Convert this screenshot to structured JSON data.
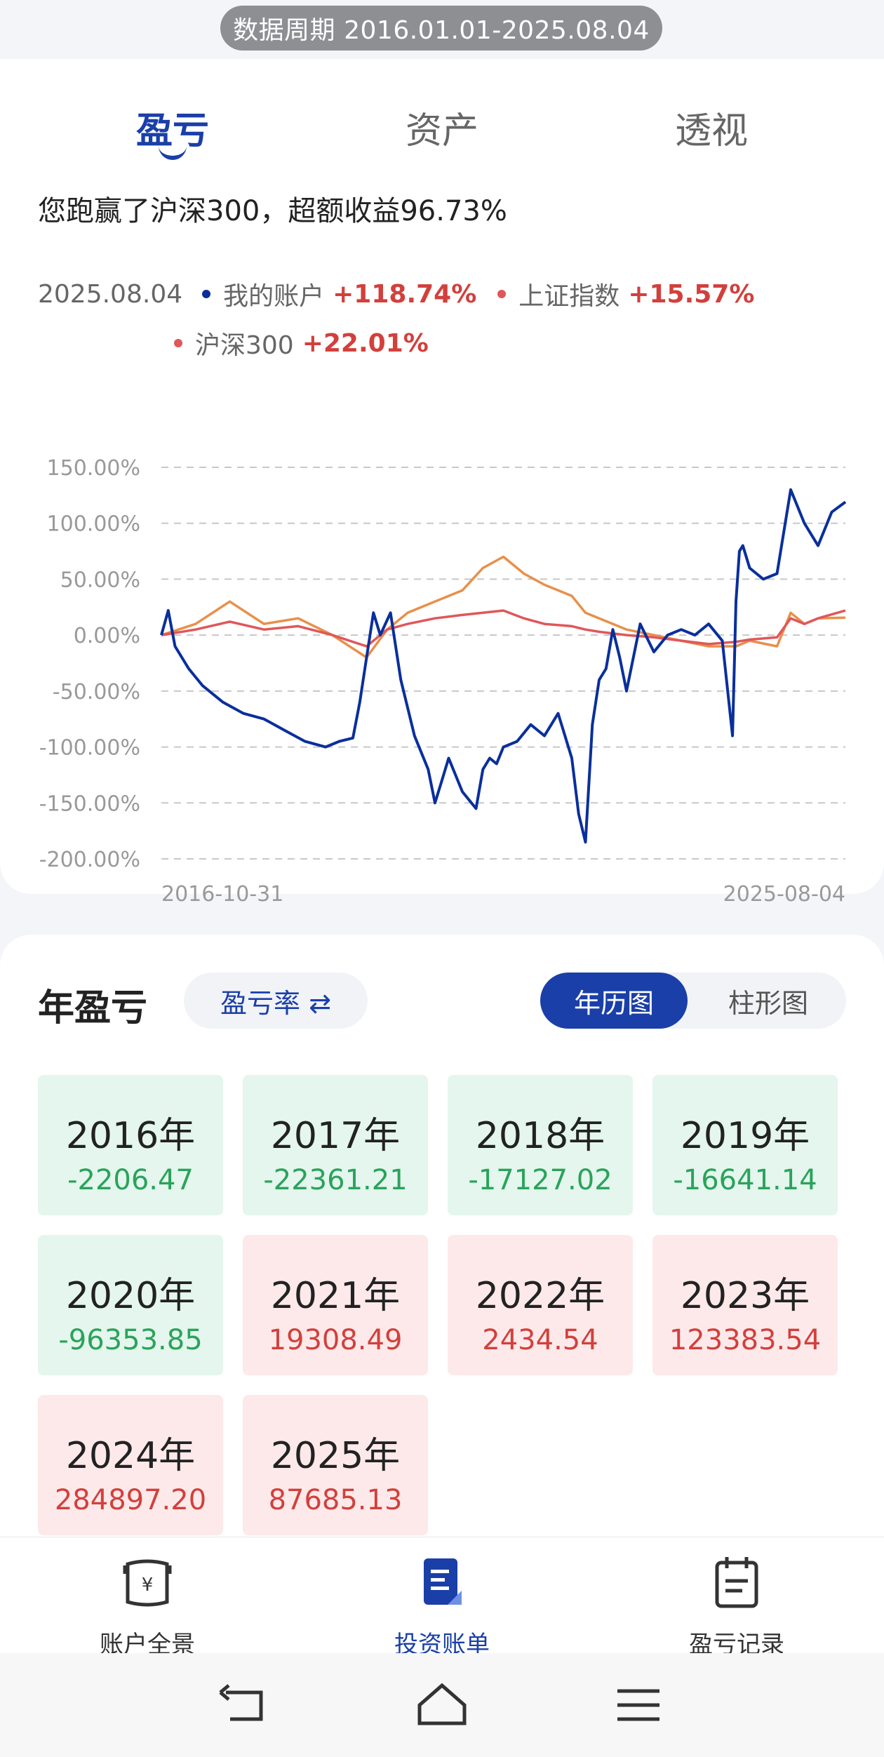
{
  "period": "数据周期 2016.01.01-2025.08.04",
  "tabs": [
    {
      "label": "盈亏",
      "active": true
    },
    {
      "label": "资产",
      "active": false
    },
    {
      "label": "透视",
      "active": false
    }
  ],
  "headline": "您跑赢了沪深300，超额收益96.73%",
  "legend": {
    "date": "2025.08.04",
    "items": [
      {
        "name": "我的账户",
        "value": "+118.74%",
        "color": "#0a2f9c"
      },
      {
        "name": "上证指数",
        "value": "+15.57%",
        "color": "#e8904a"
      },
      {
        "name": "沪深300",
        "value": "+22.01%",
        "color": "#e0575a"
      }
    ]
  },
  "chart_data": {
    "type": "line",
    "x_start": "2016-10-31",
    "x_end": "2025-08-04",
    "yticks": [
      "150.00%",
      "100.00%",
      "50.00%",
      "0.00%",
      "-50.00%",
      "-100.00%",
      "-150.00%",
      "-200.00%"
    ],
    "ylim": [
      -200,
      150
    ],
    "grid": true,
    "series": [
      {
        "name": "我的账户",
        "color": "#0a2f9c",
        "x": [
          0,
          0.01,
          0.02,
          0.04,
          0.06,
          0.09,
          0.12,
          0.15,
          0.18,
          0.21,
          0.24,
          0.26,
          0.28,
          0.29,
          0.3,
          0.31,
          0.32,
          0.335,
          0.35,
          0.37,
          0.39,
          0.4,
          0.41,
          0.42,
          0.44,
          0.46,
          0.47,
          0.48,
          0.49,
          0.5,
          0.52,
          0.54,
          0.56,
          0.58,
          0.6,
          0.61,
          0.62,
          0.63,
          0.64,
          0.65,
          0.66,
          0.67,
          0.68,
          0.7,
          0.72,
          0.74,
          0.76,
          0.78,
          0.8,
          0.82,
          0.835,
          0.84,
          0.845,
          0.85,
          0.86,
          0.88,
          0.9,
          0.92,
          0.94,
          0.96,
          0.98,
          1.0
        ],
        "y": [
          0,
          22,
          -10,
          -30,
          -45,
          -60,
          -70,
          -75,
          -85,
          -95,
          -100,
          -95,
          -92,
          -60,
          -20,
          20,
          0,
          20,
          -40,
          -90,
          -120,
          -150,
          -130,
          -110,
          -140,
          -155,
          -120,
          -110,
          -115,
          -100,
          -95,
          -80,
          -90,
          -70,
          -110,
          -160,
          -185,
          -80,
          -40,
          -30,
          5,
          -20,
          -50,
          10,
          -15,
          0,
          5,
          0,
          10,
          -5,
          -90,
          30,
          75,
          80,
          60,
          50,
          55,
          130,
          100,
          80,
          110,
          119
        ]
      },
      {
        "name": "上证指数",
        "color": "#e8904a",
        "x": [
          0,
          0.05,
          0.1,
          0.15,
          0.2,
          0.25,
          0.3,
          0.33,
          0.36,
          0.4,
          0.44,
          0.47,
          0.5,
          0.53,
          0.56,
          0.6,
          0.62,
          0.64,
          0.68,
          0.72,
          0.76,
          0.8,
          0.84,
          0.86,
          0.9,
          0.92,
          0.94,
          0.96,
          1.0
        ],
        "y": [
          0,
          10,
          30,
          10,
          15,
          0,
          -20,
          5,
          20,
          30,
          40,
          60,
          70,
          55,
          45,
          35,
          20,
          15,
          5,
          0,
          -5,
          -10,
          -10,
          -5,
          -10,
          20,
          10,
          15,
          15.6
        ]
      },
      {
        "name": "沪深300",
        "color": "#e0575a",
        "x": [
          0,
          0.05,
          0.1,
          0.15,
          0.2,
          0.25,
          0.3,
          0.33,
          0.36,
          0.4,
          0.44,
          0.47,
          0.5,
          0.53,
          0.56,
          0.6,
          0.62,
          0.64,
          0.68,
          0.72,
          0.76,
          0.8,
          0.84,
          0.86,
          0.9,
          0.92,
          0.94,
          0.96,
          1.0
        ],
        "y": [
          0,
          5,
          12,
          5,
          8,
          0,
          -10,
          5,
          10,
          15,
          18,
          20,
          22,
          15,
          10,
          8,
          5,
          3,
          0,
          -2,
          -5,
          -8,
          -6,
          -4,
          -2,
          15,
          10,
          15,
          22
        ]
      }
    ]
  },
  "year_section": {
    "title": "年盈亏",
    "rate_toggle": "盈亏率 ⇄",
    "view_calendar": "年历图",
    "view_bar": "柱形图",
    "years": [
      {
        "year": "2016年",
        "value": "-2206.47",
        "sign": "loss"
      },
      {
        "year": "2017年",
        "value": "-22361.21",
        "sign": "loss"
      },
      {
        "year": "2018年",
        "value": "-17127.02",
        "sign": "loss"
      },
      {
        "year": "2019年",
        "value": "-16641.14",
        "sign": "loss"
      },
      {
        "year": "2020年",
        "value": "-96353.85",
        "sign": "loss"
      },
      {
        "year": "2021年",
        "value": "19308.49",
        "sign": "gain"
      },
      {
        "year": "2022年",
        "value": "2434.54",
        "sign": "gain"
      },
      {
        "year": "2023年",
        "value": "123383.54",
        "sign": "gain"
      },
      {
        "year": "2024年",
        "value": "284897.20",
        "sign": "gain"
      },
      {
        "year": "2025年",
        "value": "87685.13",
        "sign": "gain"
      }
    ]
  },
  "bottom_nav": [
    {
      "label": "账户全景",
      "icon": "ledger-yuan-icon"
    },
    {
      "label": "投资账单",
      "icon": "bill-icon",
      "active": true
    },
    {
      "label": "盈亏记录",
      "icon": "calendar-record-icon"
    }
  ]
}
